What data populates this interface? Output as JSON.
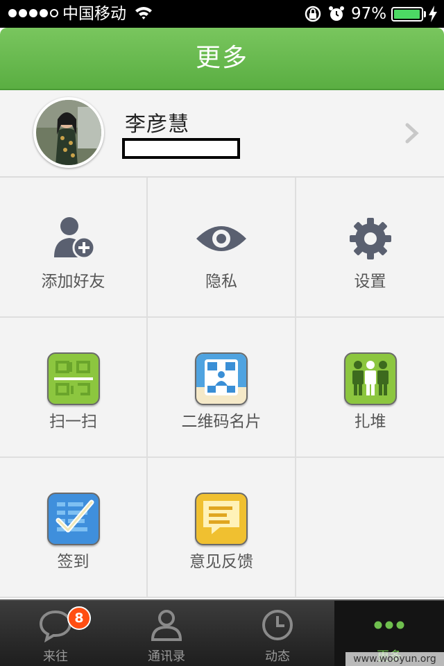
{
  "status_bar": {
    "carrier": "中国移动",
    "battery_text": "97%",
    "battery_level": 0.97,
    "signal_bars_filled": 4,
    "signal_bars_total": 5
  },
  "header": {
    "title": "更多"
  },
  "profile": {
    "name": "李彦慧"
  },
  "grid": {
    "add_friend": "添加好友",
    "privacy": "隐私",
    "settings": "设置",
    "scan": "扫一扫",
    "qr_card": "二维码名片",
    "group": "扎堆",
    "checkin": "签到",
    "feedback": "意见反馈"
  },
  "tabbar": {
    "tabs": [
      {
        "label": "来往",
        "icon": "chat-bubble-icon",
        "badge": "8"
      },
      {
        "label": "通讯录",
        "icon": "contacts-icon"
      },
      {
        "label": "动态",
        "icon": "clock-icon"
      },
      {
        "label": "更多",
        "icon": "more-dots-icon",
        "active": true
      }
    ]
  },
  "watermark": "www.wooyun.org",
  "colors": {
    "header_green": "#5aae42",
    "active_tab_green": "#6fbf4e",
    "badge_red": "#ff4e12"
  }
}
